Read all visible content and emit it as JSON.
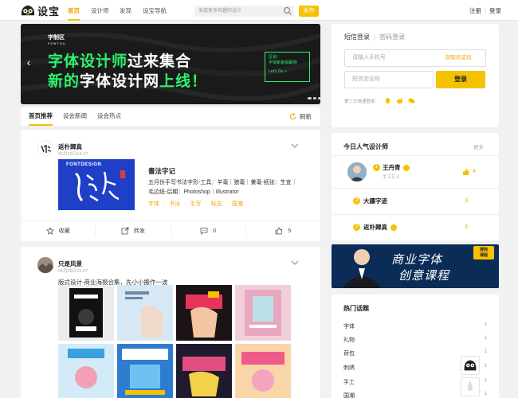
{
  "header": {
    "logo_text": "设宝",
    "nav": [
      "首页",
      "设计师",
      "发现",
      "设宝导航"
    ],
    "search_placeholder": "发现更多有趣的设计",
    "publish": "发布",
    "register": "注册",
    "login": "登录",
    "sep": "|"
  },
  "banner": {
    "logo_line1": "字制区",
    "logo_line2": "FONTOU",
    "title1_green": "字体设计师",
    "title1_white": "过来集合",
    "title2_green1": "新的",
    "title2_white": "字体设计网",
    "title2_green2": "上线！",
    "box_line1": "区长!",
    "box_line2": "字体新家揭幕啦!",
    "cta": "Let's Go >"
  },
  "tabs": {
    "recommend": "首页推荐",
    "news": "设会新闻",
    "hot": "设会热点",
    "refresh": "刷新"
  },
  "post1": {
    "user": "返朴歸真",
    "time": "05月29日14:17",
    "thumb_text": "FONTDESIGN",
    "title": "書法字记",
    "desc": "五月份手写书法字形-工具：羊毫｜狼毫｜兼毫-纸张：生宣｜毛边纸-后期：Photoshop｜Illustrator",
    "tags": "字体 · 书法 · 手写 · 标志 · 国潮",
    "collect": "收藏",
    "share": "转发",
    "comments": "0",
    "likes": "5"
  },
  "post2": {
    "user": "只是风景",
    "time": "05月28日15:27",
    "desc": "版式设计-商业海报合集，先小小搬作一波"
  },
  "login": {
    "tab_sms": "短信登录",
    "sep": "|",
    "tab_pwd": "密码登录",
    "phone_placeholder": "请输入手机号",
    "get_code": "获取验证码",
    "code_placeholder": "短信验证码",
    "button": "登录",
    "third_label": "第三方快速登录："
  },
  "hot_designers": {
    "title": "今日人气设计师",
    "more": "更多",
    "rows": [
      {
        "rank": "1",
        "name": "王丹青",
        "subtitle": "手工艺人",
        "count": "4"
      },
      {
        "rank": "2",
        "name": "大疆字迹",
        "subtitle": "",
        "count": "3"
      },
      {
        "rank": "3",
        "name": "返朴歸真",
        "subtitle": "",
        "count": "3"
      }
    ]
  },
  "ad": {
    "line1": "商业字体",
    "line2": "创意课程",
    "badge1": "搜狗",
    "badge2": "课程"
  },
  "topics": {
    "title": "热门话题",
    "items": [
      {
        "name": "字体",
        "count": "1"
      },
      {
        "name": "礼物",
        "count": "1"
      },
      {
        "name": "荷包",
        "count": "1"
      },
      {
        "name": "刺绣",
        "count": "1"
      },
      {
        "name": "手工",
        "count": "1"
      },
      {
        "name": "国潮",
        "count": "1"
      }
    ]
  },
  "colors": {
    "accent": "#f5c200",
    "green": "#2ef26f",
    "banner_bg": "#1c1c1c"
  }
}
